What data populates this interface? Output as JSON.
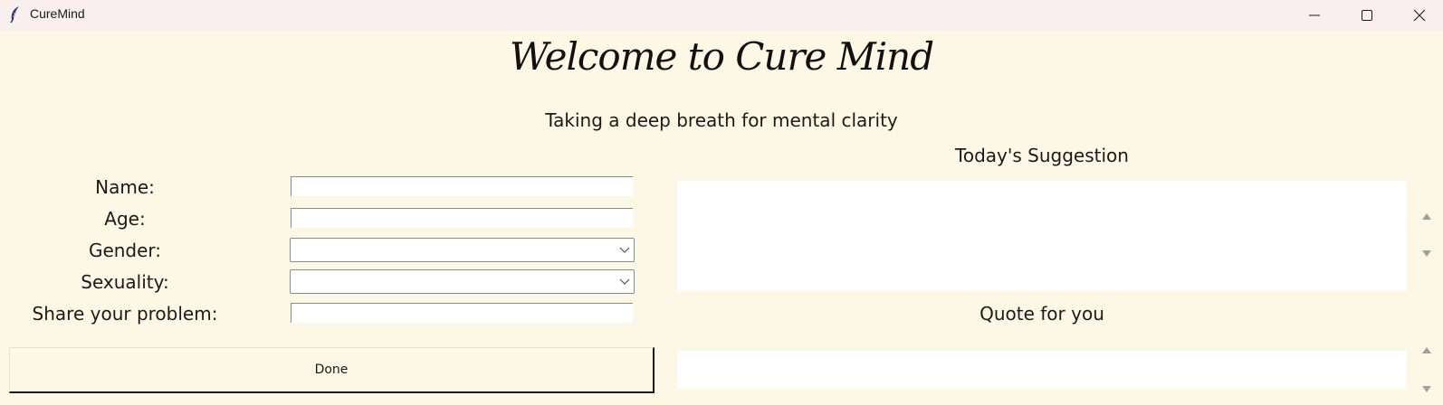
{
  "window": {
    "title": "CureMind",
    "icons": {
      "app": "feather-icon",
      "minimize": "minimize-icon",
      "maximize": "maximize-icon",
      "close": "close-icon"
    }
  },
  "header": {
    "title": "Welcome to Cure Mind",
    "subtitle": "Taking a deep breath for mental clarity"
  },
  "form": {
    "name_label": "Name:",
    "name_value": "",
    "age_label": "Age:",
    "age_value": "",
    "gender_label": "Gender:",
    "gender_value": "",
    "sexuality_label": "Sexuality:",
    "sexuality_value": "",
    "problem_label": "Share your problem:",
    "problem_value": "",
    "done_label": "Done"
  },
  "suggestion": {
    "title": "Today's Suggestion",
    "text": ""
  },
  "quote": {
    "title": "Quote for you",
    "text": ""
  },
  "colors": {
    "background": "#fdf8e6",
    "titlebar": "#f9efef",
    "field": "#ffffff"
  }
}
